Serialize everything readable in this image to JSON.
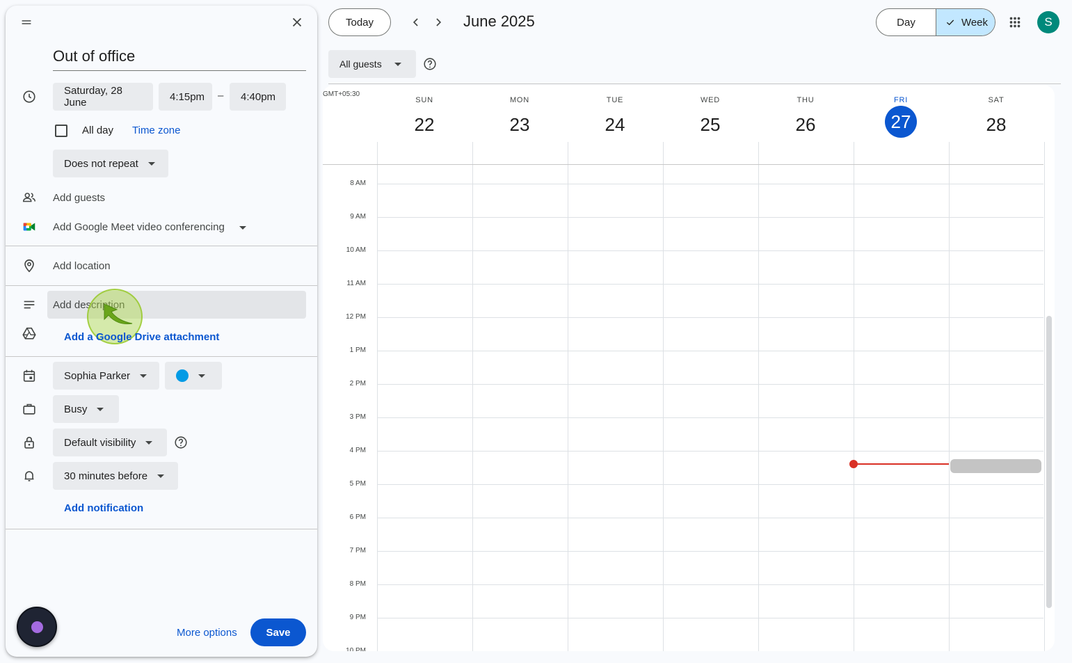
{
  "event_panel": {
    "title": "Out of office",
    "date": "Saturday, 28 June",
    "start_time": "4:15pm",
    "dash": "–",
    "end_time": "4:40pm",
    "all_day_label": "All day",
    "time_zone_label": "Time zone",
    "repeat": "Does not repeat",
    "add_guests": "Add guests",
    "meet": "Add Google Meet video conferencing",
    "add_location": "Add location",
    "description_placeholder": "Add description",
    "drive_attachment": "Add a Google Drive attachment",
    "calendar_owner": "Sophia Parker",
    "calendar_color": "#039be5",
    "availability": "Busy",
    "visibility": "Default visibility",
    "notification": "30 minutes before",
    "add_notification": "Add notification",
    "more_options": "More options",
    "save": "Save"
  },
  "topbar": {
    "today": "Today",
    "month_title": "June 2025",
    "view_day": "Day",
    "view_week": "Week",
    "avatar_letter": "S",
    "guests_filter": "All guests"
  },
  "calendar": {
    "timezone": "GMT+05:30",
    "days": [
      {
        "dow": "SUN",
        "num": "22"
      },
      {
        "dow": "MON",
        "num": "23"
      },
      {
        "dow": "TUE",
        "num": "24"
      },
      {
        "dow": "WED",
        "num": "25"
      },
      {
        "dow": "THU",
        "num": "26"
      },
      {
        "dow": "FRI",
        "num": "27",
        "today": true
      },
      {
        "dow": "SAT",
        "num": "28"
      }
    ],
    "hours": [
      "8 AM",
      "9 AM",
      "10 AM",
      "11 AM",
      "12 PM",
      "1 PM",
      "2 PM",
      "3 PM",
      "4 PM",
      "5 PM",
      "6 PM",
      "7 PM",
      "8 PM",
      "9 PM",
      "10 PM"
    ]
  },
  "colors": {
    "accent": "#0b57d0",
    "now_line": "#d93025",
    "avatar_bg": "#00897b",
    "draft_event": "#c4c4c4"
  }
}
